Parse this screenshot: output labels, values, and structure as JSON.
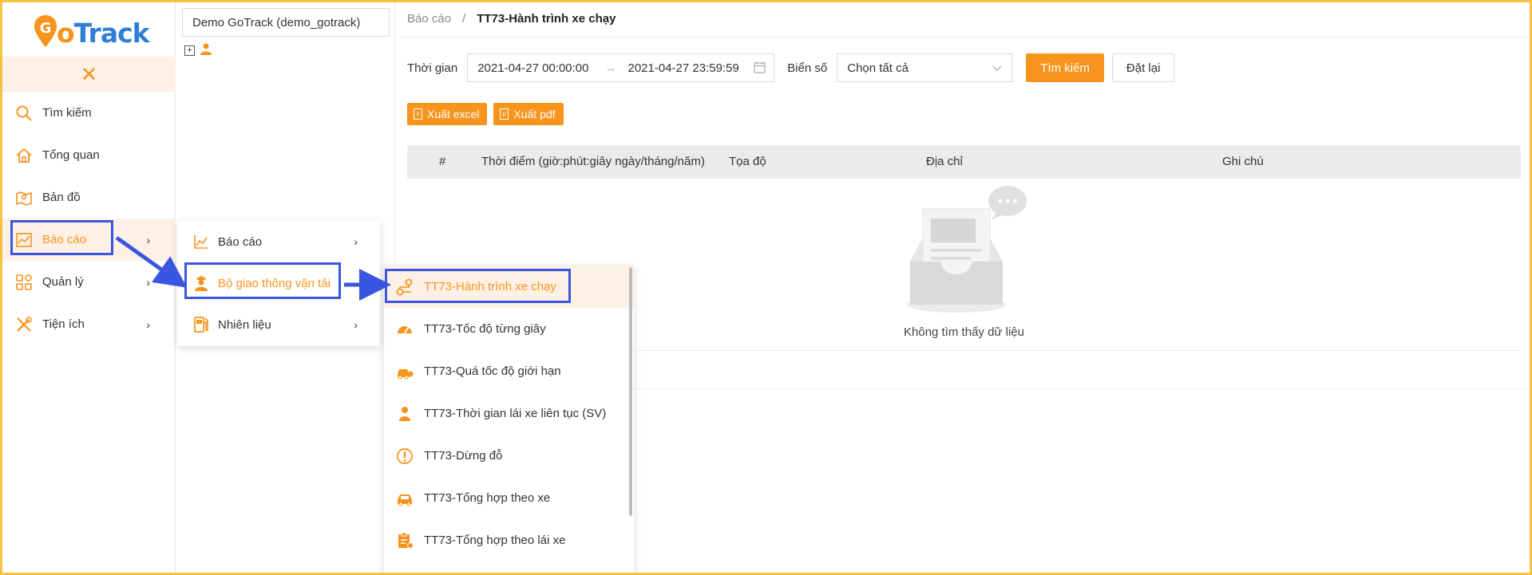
{
  "app": {
    "logo_text_g": "G",
    "logo_text_o": "o",
    "logo_text_rest": "Track"
  },
  "sidebar": {
    "close_icon": "close-icon",
    "items": [
      {
        "label": "Tìm kiếm",
        "icon": "search-icon"
      },
      {
        "label": "Tổng quan",
        "icon": "home-icon"
      },
      {
        "label": "Bản đồ",
        "icon": "map-icon"
      },
      {
        "label": "Báo cáo",
        "icon": "chart-icon",
        "active": true
      },
      {
        "label": "Quản lý",
        "icon": "grid-icon"
      },
      {
        "label": "Tiện ích",
        "icon": "tools-icon"
      }
    ]
  },
  "tree": {
    "company": "Demo GoTrack (demo_gotrack)"
  },
  "breadcrumb": {
    "root": "Báo cáo",
    "sep": "/",
    "current": "TT73-Hành trình xe chạy"
  },
  "filter": {
    "time_label": "Thời gian",
    "start": "2021-04-27 00:00:00",
    "end": "2021-04-27 23:59:59",
    "plate_label": "Biển số",
    "plate_value": "Chọn tất cả",
    "search_label": "Tìm kiếm",
    "reset_label": "Đặt lại"
  },
  "exports": {
    "excel": "Xuất excel",
    "pdf": "Xuất pdf"
  },
  "table": {
    "columns": [
      "#",
      "Thời điểm (giờ:phút:giây ngày/tháng/năm)",
      "Tọa độ",
      "Địa chỉ",
      "Ghi chú"
    ],
    "empty_text": "Không tìm thấy dữ liệu"
  },
  "menu1": {
    "items": [
      {
        "label": "Báo cáo",
        "icon": "line-chart-icon"
      },
      {
        "label": "Bộ giao thông vận tải",
        "icon": "officer-icon",
        "active": true
      },
      {
        "label": "Nhiên liệu",
        "icon": "fuel-icon"
      }
    ]
  },
  "menu2": {
    "items": [
      {
        "label": "TT73-Hành trình xe chạy",
        "icon": "route-icon",
        "active": true
      },
      {
        "label": "TT73-Tốc độ từng giây",
        "icon": "speedometer-icon"
      },
      {
        "label": "TT73-Quá tốc độ giới hạn",
        "icon": "car-speed-icon"
      },
      {
        "label": "TT73-Thời gian lái xe liên tục (SV)",
        "icon": "driver-icon"
      },
      {
        "label": "TT73-Dừng đỗ",
        "icon": "alert-icon"
      },
      {
        "label": "TT73-Tổng hợp theo xe",
        "icon": "car-icon"
      },
      {
        "label": "TT73-Tổng hợp theo lái xe",
        "icon": "clipboard-icon"
      }
    ]
  },
  "colors": {
    "accent": "#f7941d",
    "brand_blue": "#2f7fd6",
    "highlight": "#3a55e0",
    "frame": "#f7c243"
  }
}
